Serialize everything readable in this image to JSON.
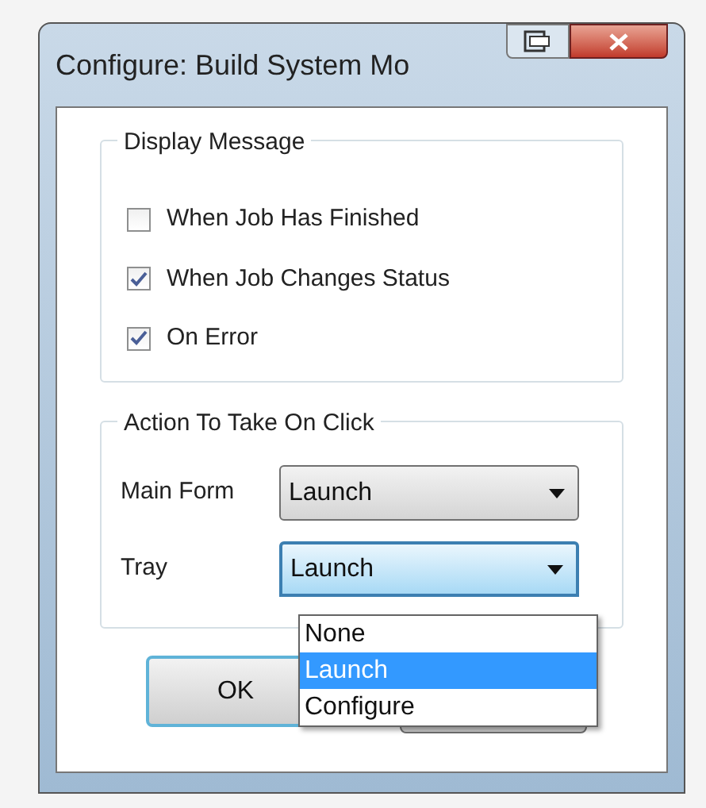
{
  "window": {
    "title": "Configure: Build System Mo"
  },
  "display_message": {
    "title": "Display Message",
    "options": [
      {
        "label": "When Job Has Finished",
        "checked": false
      },
      {
        "label": "When Job Changes Status",
        "checked": true
      },
      {
        "label": "On Error",
        "checked": true
      }
    ]
  },
  "action": {
    "title": "Action To Take On Click",
    "fields": [
      {
        "label": "Main Form",
        "value": "Launch",
        "focused": false,
        "open": false
      },
      {
        "label": "Tray",
        "value": "Launch",
        "focused": true,
        "open": true
      }
    ]
  },
  "dropdown": [
    {
      "label": "None",
      "selected": false
    },
    {
      "label": "Launch",
      "selected": true
    },
    {
      "label": "Configure",
      "selected": false
    }
  ],
  "buttons": [
    {
      "label": "OK",
      "kind": "default"
    },
    {
      "kind": "hidden"
    }
  ]
}
